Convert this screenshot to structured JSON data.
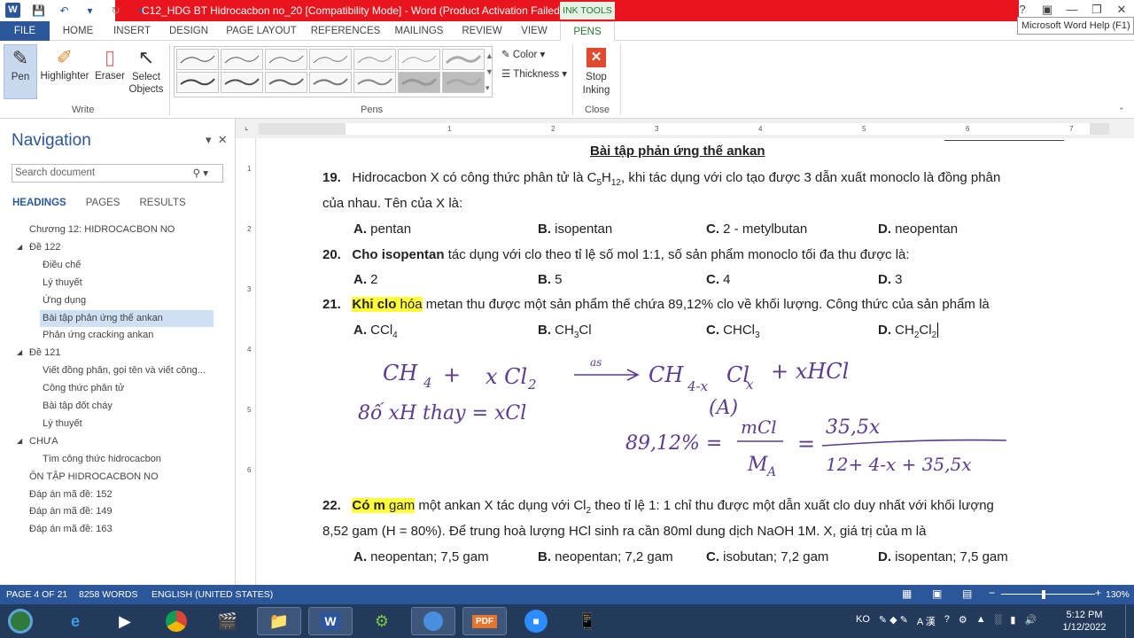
{
  "titlebar": {
    "doc_title": "C12_HDG BT Hidrocacbon no_20 [Compatibility Mode] - Word (Product Activation Failed)",
    "context_tab": "INK TOOLS",
    "tooltip": "Microsoft Word Help (F1)",
    "help": "?"
  },
  "tabs": [
    "FILE",
    "HOME",
    "INSERT",
    "DESIGN",
    "PAGE LAYOUT",
    "REFERENCES",
    "MAILINGS",
    "REVIEW",
    "VIEW",
    "PENS"
  ],
  "ribbon": {
    "write": {
      "pen": "Pen",
      "highlighter": "Highlighter",
      "eraser": "Eraser",
      "select": "Select Objects",
      "group": "Write"
    },
    "pens": {
      "group": "Pens",
      "color": "Color",
      "thickness": "Thickness"
    },
    "close": {
      "stop": "Stop Inking",
      "group": "Close"
    }
  },
  "nav": {
    "title": "Navigation",
    "search_placeholder": "Search document",
    "tabs": [
      "HEADINGS",
      "PAGES",
      "RESULTS"
    ],
    "items": [
      {
        "label": "Chương 12: HIDROCACBON NO",
        "level": 1
      },
      {
        "label": "Đề 122",
        "level": 1,
        "expanded": true
      },
      {
        "label": "Điều chế",
        "level": 2
      },
      {
        "label": "Lý thuyết",
        "level": 2
      },
      {
        "label": "Ứng dụng",
        "level": 2
      },
      {
        "label": "Bài tập phản ứng thế ankan",
        "level": 2,
        "selected": true
      },
      {
        "label": "Phản ứng cracking ankan",
        "level": 2
      },
      {
        "label": "Đề 121",
        "level": 1,
        "expanded": true
      },
      {
        "label": "Viết đồng phân, gọi tên và viết công...",
        "level": 2
      },
      {
        "label": "Công thức phân tử",
        "level": 2
      },
      {
        "label": "Bài tập đốt cháy",
        "level": 2
      },
      {
        "label": "Lý thuyết",
        "level": 2
      },
      {
        "label": "CHƯA",
        "level": 1,
        "expanded": true
      },
      {
        "label": "Tìm công thức hidrocacbon",
        "level": 2
      },
      {
        "label": "ÔN TẬP HIDROCACBON NO",
        "level": 1
      },
      {
        "label": "Đáp án mã đề: 152",
        "level": 1
      },
      {
        "label": " Đáp án mã đề: 149",
        "level": 1
      },
      {
        "label": "Đáp án mã đề: 163",
        "level": 1
      }
    ]
  },
  "ruler": [
    "1",
    "2",
    "3",
    "4",
    "5",
    "6",
    "7"
  ],
  "vruler": [
    "1",
    "2",
    "3",
    "4",
    "5",
    "6"
  ],
  "doc": {
    "heading": "Bài tập phản ứng thế ankan",
    "q19": {
      "num": "19.",
      "t1": "Hidrocacbon X có công thức phân tử là C",
      "sub1": "5",
      "t2": "H",
      "sub2": "12",
      "t3": ", khi tác dụng với clo tạo được 3 dẫn xuất monoclo là đồng phân",
      "line2": "của nhau. Tên của X là:",
      "a": "A.",
      "av": " pentan",
      "b": "B.",
      "bv": " isopentan",
      "c": "C.",
      "cv": " 2 - metylbutan",
      "d": "D.",
      "dv": " neopentan"
    },
    "q20": {
      "num": "20.",
      "bold": "Cho isopentan",
      "rest": " tác dụng với clo theo tỉ lệ số mol 1:1, số sản phẩm monoclo tối đa thu được là:",
      "a": "A.",
      "av": " 2",
      "b": "B.",
      "bv": " 5",
      "c": "C.",
      "cv": " 4",
      "d": "D.",
      "dv": " 3"
    },
    "q21": {
      "num": "21.",
      "hl_bold": "Khi clo",
      "hl": " hóa",
      "rest": " metan thu được một sản phẩm thế chứa 89,12% clo về khối lượng. Công thức của sản phẩm là",
      "a": "A.",
      "av": " CCl",
      "as": "4",
      "b": "B.",
      "bv": " CH",
      "bs": "3",
      "bv2": "Cl",
      "c": "C.",
      "cv": " CHCl",
      "cs": "3",
      "d": "D.",
      "dv": " CH",
      "ds": "2",
      "dv2": "Cl",
      "ds2": "2"
    },
    "ink": {
      "l1a": "CH",
      "l1s": "4",
      "l1b": "+",
      "l1c": "x Cl",
      "l1cs": "2",
      "l1arrow": "as",
      "l1d": "CH",
      "l1ds": "4-x",
      "l1e": "Cl",
      "l1es": "x",
      "l1f": "+ xHCl",
      "l1g": "(A)",
      "l2": "8ố xH thay = xCl",
      "eq_lhs": "89,12% =",
      "eq_num": "mCl",
      "eq_den": "M",
      "eq_dens": "A",
      "eq_eq": "=",
      "eq_num2": "35,5x",
      "eq_den2": "12+ 4-x + 35,5x"
    },
    "q22": {
      "num": "22.",
      "hl_bold": "Có m",
      "hl": " gam",
      "rest1": " một ankan X  tác dụng với Cl",
      "sub": "2",
      "rest2": " theo tỉ lệ 1: 1 chỉ thu được một dẫn xuất clo duy nhất với khối lượng",
      "line2": "8,52 gam (H = 80%). Để trung hoà lượng HCl sinh ra cần 80ml dung dịch NaOH 1M. X, giá trị của m là",
      "a": "A.",
      "av": " neopentan; 7,5 gam",
      "b": "B.",
      "bv": " neopentan; 7,2 gam",
      "c": "C.",
      "cv": " isobutan; 7,2 gam",
      "d": "D.",
      "dv": " isopentan; 7,5 gam"
    }
  },
  "status": {
    "page": "PAGE 4 OF 21",
    "words": "8258 WORDS",
    "lang": "ENGLISH (UNITED STATES)",
    "zoom": "130%"
  },
  "taskbar": {
    "time": "5:12 PM",
    "date": "1/12/2022",
    "ime": "KO",
    "ime2": "A 漢"
  }
}
